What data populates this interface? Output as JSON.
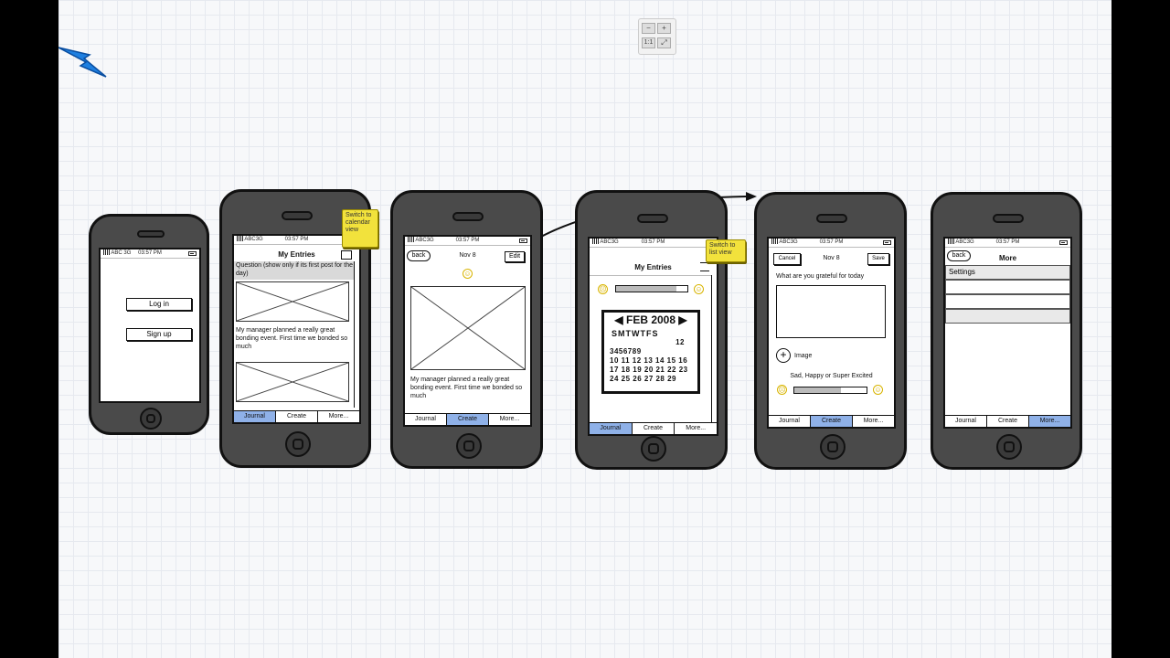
{
  "status": {
    "carrier": "ABC",
    "network": "3G",
    "time": "03:57 PM"
  },
  "login": {
    "login_label": "Log in",
    "signup_label": "Sign up"
  },
  "entries": {
    "title": "My Entries",
    "question": "Question (show only if its first post for the day)",
    "entry_text": "My manager planned a really great bonding event. First time we bonded so much",
    "note": "Switch to calendar view"
  },
  "detail": {
    "back_label": "back",
    "date": "Nov 8",
    "edit_label": "Edit",
    "entry_text": "My manager planned a really great bonding event. First time we bonded so much"
  },
  "calendar": {
    "title": "My Entries",
    "note": "Switch to list view",
    "month": "FEB 2008",
    "days_header": "SMTWTFS",
    "rows": [
      "                12",
      "3456789",
      "10 11 12 13 14 15 16",
      "17 18 19 20 21 22 23",
      "24 25 26 27 28 29"
    ]
  },
  "create": {
    "cancel_label": "Cancel",
    "date": "Nov 8",
    "save_label": "Save",
    "prompt": "What are you grateful for today",
    "image_label": "Image",
    "mood_label": "Sad, Happy or Super Excited"
  },
  "more": {
    "back_label": "back",
    "title": "More",
    "settings_label": "Settings"
  },
  "tabs": {
    "journal": "Journal",
    "create": "Create",
    "more": "More..."
  },
  "zoom": {
    "minus": "−",
    "plus": "+",
    "actual": "1:1",
    "fit": "⤢"
  },
  "colors": {
    "active_tab": "#8fb1e8",
    "sticky_note": "#f2e23c",
    "arrow": "#1e7fe0"
  },
  "icons": {
    "cursor": "arrow-cursor-icon",
    "smiley": "smiley-icon",
    "plus": "plus-circle-icon"
  }
}
